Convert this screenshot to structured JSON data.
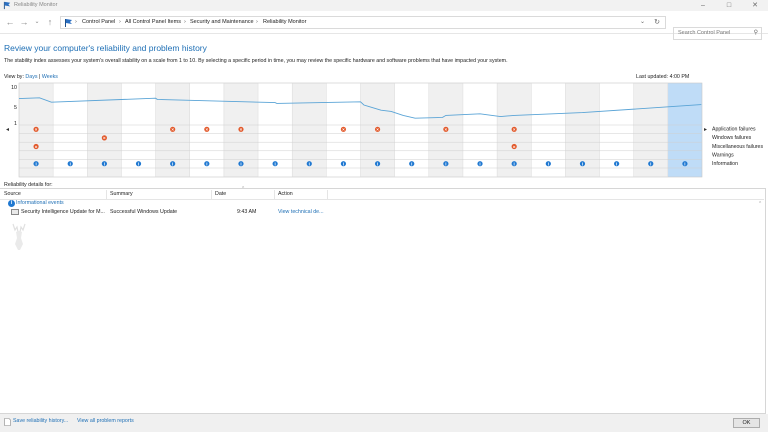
{
  "window": {
    "title": "Reliability Monitor"
  },
  "address": {
    "crumbs": [
      "Control Panel",
      "All Control Panel Items",
      "Security and Maintenance",
      "Reliability Monitor"
    ]
  },
  "search": {
    "placeholder": "Search Control Panel"
  },
  "heading": "Review your computer's reliability and problem history",
  "description": "The stability index assesses your system's overall stability on a scale from 1 to 10. By selecting a specific period in time, you may review the specific hardware and software problems that have impacted your system.",
  "viewby": {
    "label": "View by:",
    "days": "Days",
    "divider": "|",
    "weeks": "Weeks"
  },
  "last_updated": "Last updated:  4:00 PM",
  "chart": {
    "y_ticks": [
      "10",
      "5",
      "1"
    ],
    "row_labels": [
      "Application failures",
      "Windows failures",
      "Miscellaneous failures",
      "Warnings",
      "Information"
    ],
    "colors": {
      "line": "#5aa4d6",
      "error": "#e2582a",
      "info": "#1f78d1",
      "selected": "#bfdcf7"
    }
  },
  "chart_data": {
    "type": "line",
    "title": "",
    "ylim": [
      1,
      10
    ],
    "num_columns": 20,
    "selected_column": 19,
    "stability": [
      [
        0,
        7.1
      ],
      [
        0.6,
        7.3
      ],
      [
        0.95,
        6.2
      ],
      [
        4,
        7.2
      ],
      [
        4.05,
        6.9
      ],
      [
        7.5,
        6.1
      ],
      [
        7.55,
        5.9
      ],
      [
        10,
        6.3
      ],
      [
        10.1,
        5.5
      ],
      [
        10.25,
        5.1
      ],
      [
        10.6,
        4.2
      ],
      [
        10.9,
        3.9
      ],
      [
        11.25,
        2.9
      ],
      [
        11.6,
        2.2
      ],
      [
        12.4,
        2.4
      ],
      [
        12.5,
        2.9
      ],
      [
        13.5,
        3.3
      ],
      [
        14.1,
        2.6
      ],
      [
        14.5,
        2.9
      ],
      [
        16.5,
        3.6
      ],
      [
        19.98,
        5.6
      ]
    ],
    "application_failures": [
      0,
      4,
      5,
      6,
      9,
      10,
      12,
      14
    ],
    "windows_failures": [
      2
    ],
    "miscellaneous_failures": [
      0,
      14
    ],
    "warnings": [],
    "information": [
      0,
      1,
      2,
      3,
      4,
      5,
      6,
      7,
      8,
      9,
      10,
      11,
      12,
      13,
      14,
      15,
      16,
      17,
      18,
      19
    ]
  },
  "details": {
    "label": "Reliability details for:",
    "columns": [
      "Source",
      "Summary",
      "Date",
      "Action"
    ],
    "group": "Informational events",
    "rows": [
      {
        "source": "Security Intelligence Update for M...",
        "summary": "Successful Windows Update",
        "date": "9:43 AM",
        "action": "View technical de..."
      }
    ]
  },
  "footer": {
    "save": "Save reliability history...",
    "view_all": "View all problem reports",
    "ok": "OK"
  }
}
